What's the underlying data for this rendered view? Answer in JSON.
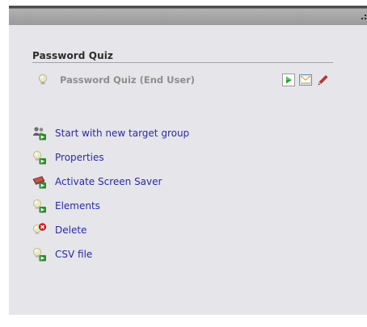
{
  "panel": {
    "section_title": "Password Quiz",
    "quiz_item": {
      "label": "Password Quiz (End User)",
      "icon": "lightbulb-icon",
      "actions": [
        {
          "name": "play-button",
          "icon": "play-icon"
        },
        {
          "name": "mail-button",
          "icon": "envelope-icon"
        },
        {
          "name": "edit-button",
          "icon": "pencil-icon"
        }
      ]
    },
    "menu": [
      {
        "label": "Start with new target group",
        "icon": "target-group-icon"
      },
      {
        "label": "Properties",
        "icon": "properties-icon"
      },
      {
        "label": "Activate Screen Saver",
        "icon": "screensaver-icon"
      },
      {
        "label": "Elements",
        "icon": "elements-icon"
      },
      {
        "label": "Delete",
        "icon": "delete-icon"
      },
      {
        "label": "CSV file",
        "icon": "csv-icon"
      }
    ]
  },
  "colors": {
    "link": "#2b2ba6",
    "panel_background": "#e5e5ea",
    "muted_text": "#8e8e8e"
  }
}
